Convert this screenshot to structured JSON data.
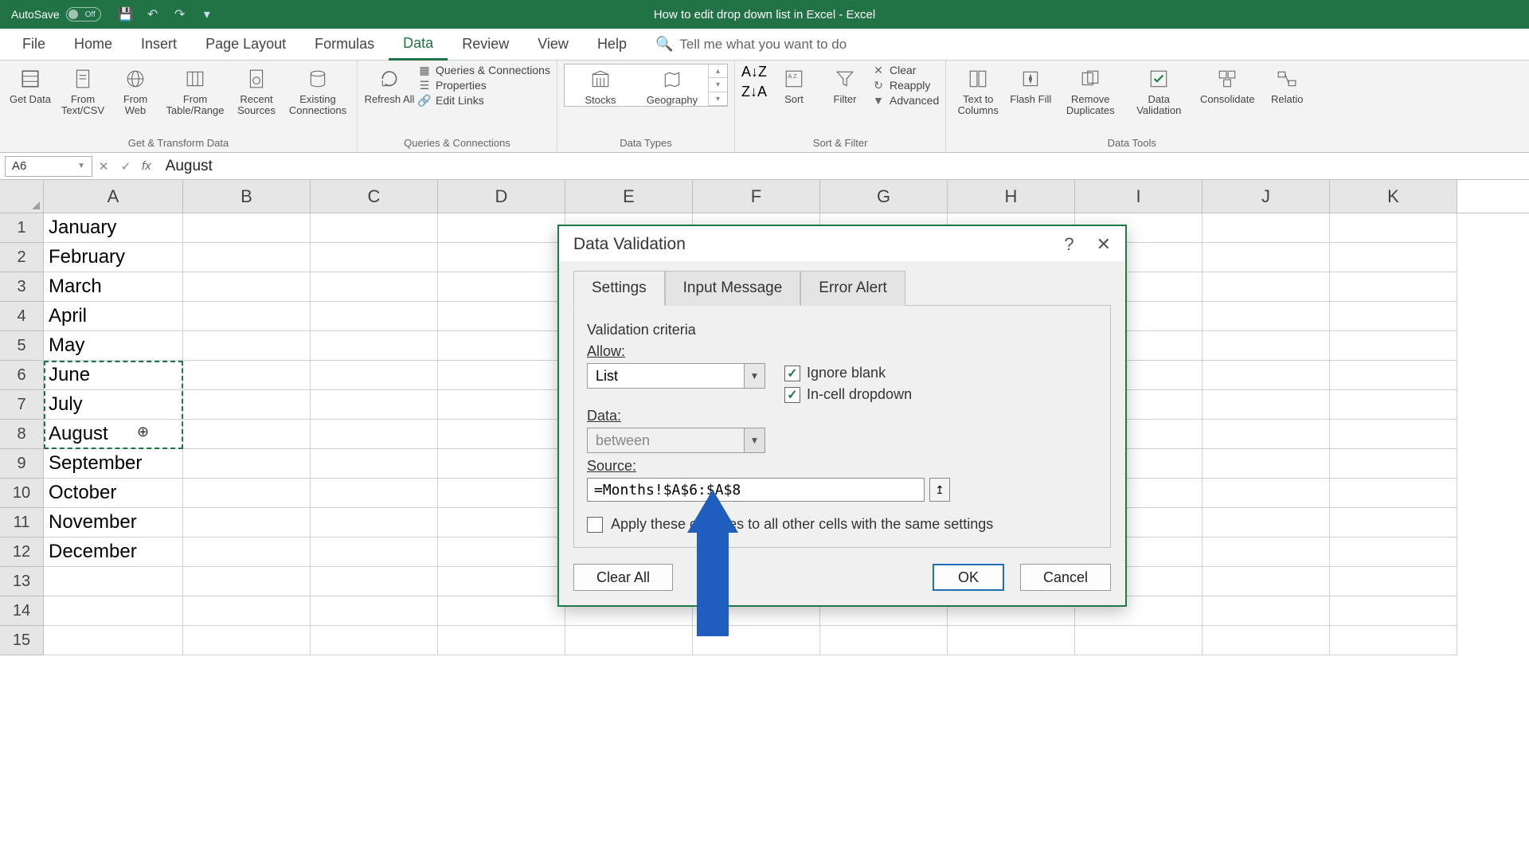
{
  "titlebar": {
    "autosave_label": "AutoSave",
    "autosave_state": "Off",
    "title": "How to edit drop down list in Excel  -  Excel"
  },
  "ribbon_tabs": [
    "File",
    "Home",
    "Insert",
    "Page Layout",
    "Formulas",
    "Data",
    "Review",
    "View",
    "Help"
  ],
  "active_tab": "Data",
  "tellme_placeholder": "Tell me what you want to do",
  "ribbon": {
    "groups": {
      "get_transform": {
        "label": "Get & Transform Data",
        "buttons": [
          "Get Data",
          "From Text/CSV",
          "From Web",
          "From Table/Range",
          "Recent Sources",
          "Existing Connections"
        ]
      },
      "queries": {
        "label": "Queries & Connections",
        "refresh": "Refresh All",
        "items": [
          "Queries & Connections",
          "Properties",
          "Edit Links"
        ]
      },
      "data_types": {
        "label": "Data Types",
        "buttons": [
          "Stocks",
          "Geography"
        ]
      },
      "sort_filter": {
        "label": "Sort & Filter",
        "sort": "Sort",
        "filter": "Filter",
        "items": [
          "Clear",
          "Reapply",
          "Advanced"
        ]
      },
      "data_tools": {
        "label": "Data Tools",
        "buttons": [
          "Text to Columns",
          "Flash Fill",
          "Remove Duplicates",
          "Data Validation",
          "Consolidate",
          "Relatio"
        ]
      }
    }
  },
  "formula_bar": {
    "name_box": "A6",
    "value": "August"
  },
  "columns": [
    "A",
    "B",
    "C",
    "D",
    "E",
    "F",
    "G",
    "H",
    "I",
    "J",
    "K"
  ],
  "row_data": [
    "January",
    "February",
    "March",
    "April",
    "May",
    "June",
    "July",
    "August",
    "September",
    "October",
    "November",
    "December",
    "",
    "",
    ""
  ],
  "dialog": {
    "title": "Data Validation",
    "tabs": [
      "Settings",
      "Input Message",
      "Error Alert"
    ],
    "criteria_label": "Validation criteria",
    "allow_label": "Allow:",
    "allow_value": "List",
    "data_label": "Data:",
    "data_value": "between",
    "ignore_blank": "Ignore blank",
    "incell_dropdown": "In-cell dropdown",
    "source_label": "Source:",
    "source_value": "=Months!$A$6:$A$8",
    "apply_label": "Apply these changes to all other cells with the same settings",
    "clear_all": "Clear All",
    "ok": "OK",
    "cancel": "Cancel"
  }
}
